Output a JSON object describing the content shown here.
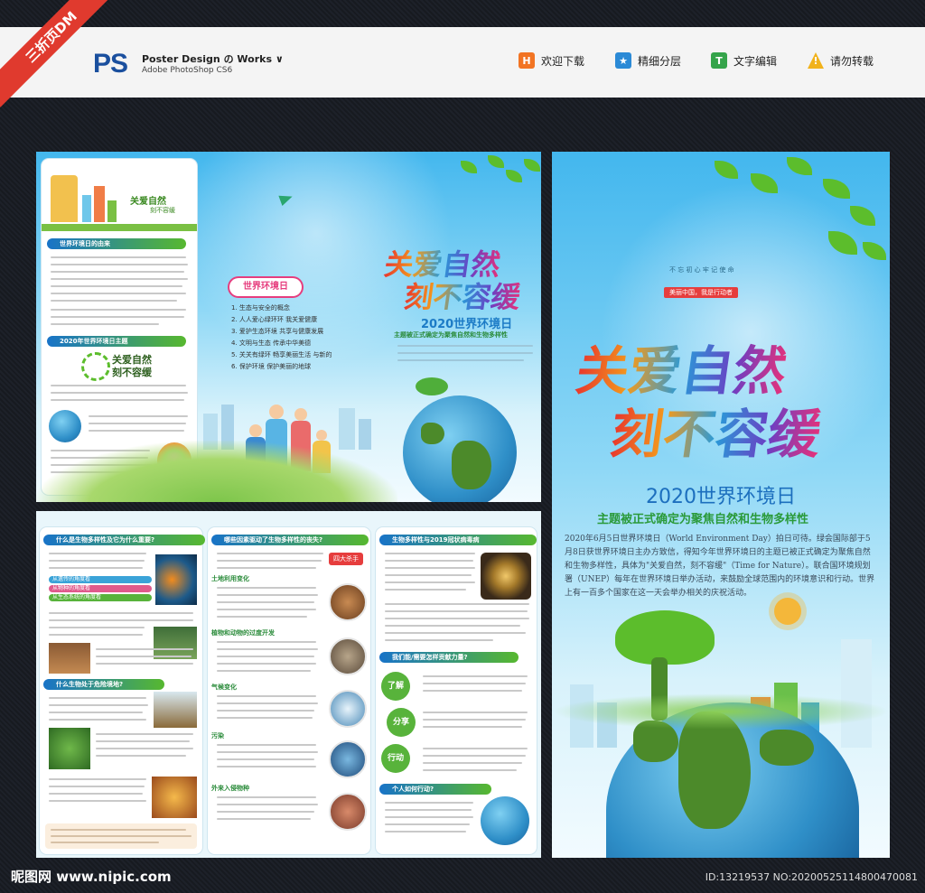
{
  "header": {
    "ribbon": "三折页DM",
    "brand_logo": "PS",
    "brand_line1": "Poster Design の Works ∨",
    "brand_line2": "Adobe PhotoShop CS6",
    "features": [
      {
        "icon": "H",
        "label": "欢迎下载",
        "color": "#f27423"
      },
      {
        "icon": "★",
        "label": "精细分层",
        "color": "#2b8ad6"
      },
      {
        "icon": "T",
        "label": "文字编辑",
        "color": "#35a44b"
      },
      {
        "icon": "!",
        "label": "请勿转载",
        "color": "#f1b21b"
      }
    ]
  },
  "left_panel": {
    "card_title1": "关爱自然",
    "card_title2": "刻不容缓",
    "sec1": "世界环境日的由来",
    "sec2": "2020年世界环境日主题",
    "card_slogan1": "关爱自然",
    "card_slogan2": "刻不容缓"
  },
  "middle_panel": {
    "badge": "世界环境日",
    "list": [
      "1. 生态与安全的概念",
      "2. 人人爱心绿环环 我关爱健康",
      "3. 爱护生态环境 共享与健康发展",
      "4. 文明与生态 传承中华美德",
      "5. 关关有绿环 畅享美丽生活 与新的",
      "6. 保护环境 保护美丽的地球"
    ]
  },
  "front_cover": {
    "title_line1": "关爱自然",
    "title_line2": "刻不容缓",
    "subtitle": "2020世界环境日",
    "theme": "主题被正式确定为聚焦自然和生物多样性",
    "tag_small": "不 忘 初 心   牢 记 使 命",
    "tag_red": "美丽中国，我是行动者",
    "body": "2020年6月5日世界环境日（World Environment Day）拍日可待。绿会国际部于5月8日获世界环境日主办方致信，得知今年世界环境日的主题已被正式确定为聚焦自然和生物多样性，具体为\"关爱自然，刻不容缓\"（Time for Nature）。联合国环境规划署（UNEP）每年在世界环境日举办活动，来鼓励全球范围内的环境意识和行动。世界上有一百多个国家在这一天会举办相关的庆祝活动。"
  },
  "small_cover": {
    "title_line1": "关爱自然",
    "title_line2": "刻不容缓",
    "subtitle": "2020世界环境日",
    "theme": "主题被正式确定为聚焦自然和生物多样性"
  },
  "inner_left": {
    "sec1": "什么是生物多样性及它为什么重要?",
    "sec2": "什么生物处于危险境地?",
    "pills": [
      "从遗传的角度看",
      "从物种的角度看",
      "从生态系统的角度看"
    ]
  },
  "inner_mid": {
    "sec1": "哪些因素驱动了生物多样性的丧失?",
    "stamp": "四大杀手",
    "subs": [
      "土地利用变化",
      "植物和动物的过度开发",
      "气候变化",
      "污染",
      "外来入侵物种"
    ]
  },
  "inner_right": {
    "sec1": "生物多样性与2019冠状病毒病",
    "sec2": "我们能/需要怎样贡献力量?",
    "circles": [
      "了解",
      "分享",
      "行动"
    ],
    "sec3": "个人如何行动?"
  },
  "footer": {
    "logo": "昵图网 www.nipic.com",
    "id": "ID:13219537 NO:20200525114800470081"
  }
}
